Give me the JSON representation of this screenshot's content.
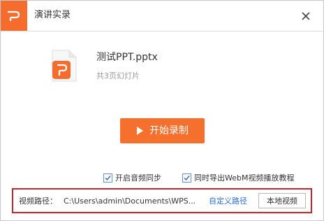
{
  "window": {
    "title": "演讲实录"
  },
  "file": {
    "name": "测试PPT.pptx",
    "slide_count_text": "共3页幻灯片"
  },
  "actions": {
    "start_record_label": "开始录制"
  },
  "options": [
    {
      "label": "开启音频同步",
      "checked": true
    },
    {
      "label": "同时导出WebM视频播放教程",
      "checked": true
    }
  ],
  "save_path": {
    "label": "视频路径：",
    "value": "C:\\Users\\admin\\Documents\\WPS...",
    "custom_link": "自定义路径",
    "local_video_button": "本地视频"
  },
  "colors": {
    "accent": "#f5702d",
    "link": "#2e6fd1",
    "highlight_border": "#c1272d"
  },
  "icons": {
    "app_logo": "wps-presentation-logo-icon",
    "close": "close-icon",
    "file": "pptx-file-icon",
    "play": "play-icon",
    "checkbox": "checkmark-icon"
  }
}
